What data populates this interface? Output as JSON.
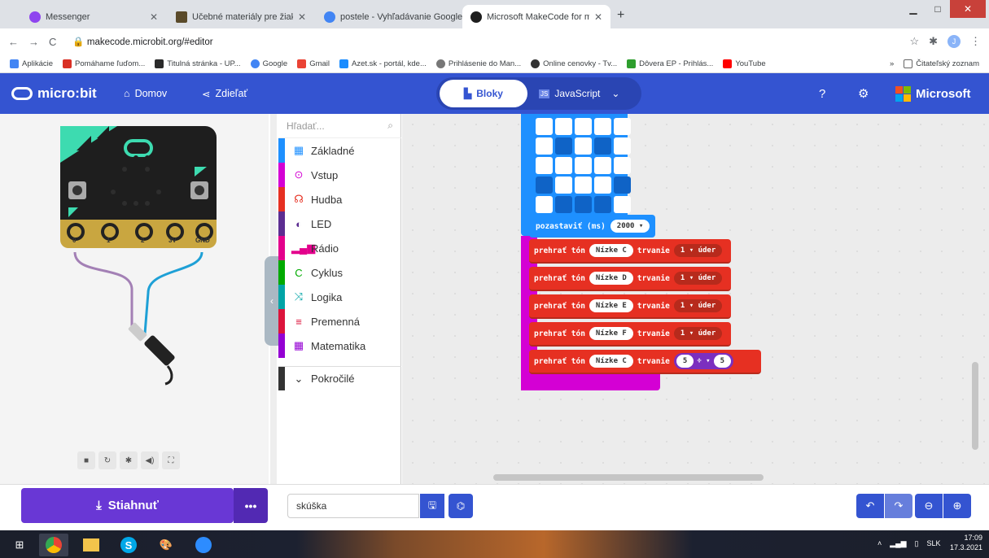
{
  "browser": {
    "tabs": [
      {
        "label": "Messenger",
        "color": "#8e44ef"
      },
      {
        "label": "Učebné materiály pre žiakov a ro",
        "color": "#5a4a2a"
      },
      {
        "label": "postele - Vyhľadávanie Google",
        "color": "#4285f4"
      },
      {
        "label": "Microsoft MakeCode for micro:bi",
        "color": "#1e1e1e",
        "active": true
      }
    ],
    "new_tab": "+",
    "url": "makecode.microbit.org/#editor",
    "bookmarks": [
      {
        "label": "Aplikácie",
        "color": "#4285f4"
      },
      {
        "label": "Pomáhame ľuďom...",
        "color": "#d93025"
      },
      {
        "label": "Titulná stránka - UP...",
        "color": "#2a2a2a"
      },
      {
        "label": "Google",
        "color": "#4285f4"
      },
      {
        "label": "Gmail",
        "color": "#ea4335"
      },
      {
        "label": "Azet.sk - portál, kde...",
        "color": "#1a8cff"
      },
      {
        "label": "Prihlásenie do Man...",
        "color": "#777777"
      },
      {
        "label": "Online cenovky - Tv...",
        "color": "#333333"
      },
      {
        "label": "Dôvera EP - Prihlás...",
        "color": "#2e9e2e"
      },
      {
        "label": "YouTube",
        "color": "#ff0000"
      }
    ],
    "reading_list": "Čitateľský zoznam",
    "more_bookmarks": "»"
  },
  "header": {
    "logo": "micro:bit",
    "home": "Domov",
    "share": "Zdieľať",
    "blocks_tab": "Bloky",
    "js_tab": "JavaScript",
    "brand": "Microsoft"
  },
  "toolbox": {
    "search_placeholder": "Hľadať...",
    "categories": [
      {
        "label": "Základné",
        "color": "#1e90ff",
        "icon": "▦"
      },
      {
        "label": "Vstup",
        "color": "#d400d4",
        "icon": "⊙"
      },
      {
        "label": "Hudba",
        "color": "#e63022",
        "icon": "☊"
      },
      {
        "label": "LED",
        "color": "#5c2d91",
        "icon": "◐"
      },
      {
        "label": "Rádio",
        "color": "#e3008c",
        "icon": "▂▄▆"
      },
      {
        "label": "Cyklus",
        "color": "#00aa00",
        "icon": "C"
      },
      {
        "label": "Logika",
        "color": "#00a4a6",
        "icon": "⤨"
      },
      {
        "label": "Premenná",
        "color": "#dc143c",
        "icon": "≡"
      },
      {
        "label": "Matematika",
        "color": "#9400d3",
        "icon": "▦"
      }
    ],
    "advanced": "Pokročilé"
  },
  "simulator": {
    "pins": [
      "0",
      "1",
      "2",
      "3V",
      "GND"
    ]
  },
  "workspace": {
    "led_grid": [
      [
        1,
        1,
        1,
        1,
        1
      ],
      [
        1,
        0,
        1,
        0,
        1
      ],
      [
        1,
        1,
        1,
        1,
        1
      ],
      [
        0,
        1,
        1,
        1,
        0
      ],
      [
        1,
        0,
        0,
        0,
        1
      ]
    ],
    "pause": {
      "label": "pozastaviť (ms)",
      "value": "2000"
    },
    "tones": [
      {
        "label": "prehrať tón",
        "note": "Nízke C",
        "dur_label": "trvanie",
        "beats": "1",
        "unit": "úder"
      },
      {
        "label": "prehrať tón",
        "note": "Nízke D",
        "dur_label": "trvanie",
        "beats": "1",
        "unit": "úder"
      },
      {
        "label": "prehrať tón",
        "note": "Nízke E",
        "dur_label": "trvanie",
        "beats": "1",
        "unit": "úder"
      },
      {
        "label": "prehrať tón",
        "note": "Nízke F",
        "dur_label": "trvanie",
        "beats": "1",
        "unit": "úder"
      }
    ],
    "last_tone": {
      "label": "prehrať tón",
      "note": "Nízke C",
      "dur_label": "trvanie",
      "a": "5",
      "op": "÷",
      "b": "5"
    }
  },
  "bottom": {
    "download": "Stiahnuť",
    "more": "•••",
    "project_name": "skúška"
  },
  "taskbar": {
    "lang": "SLK",
    "time": "17:09",
    "date": "17.3.2021"
  }
}
